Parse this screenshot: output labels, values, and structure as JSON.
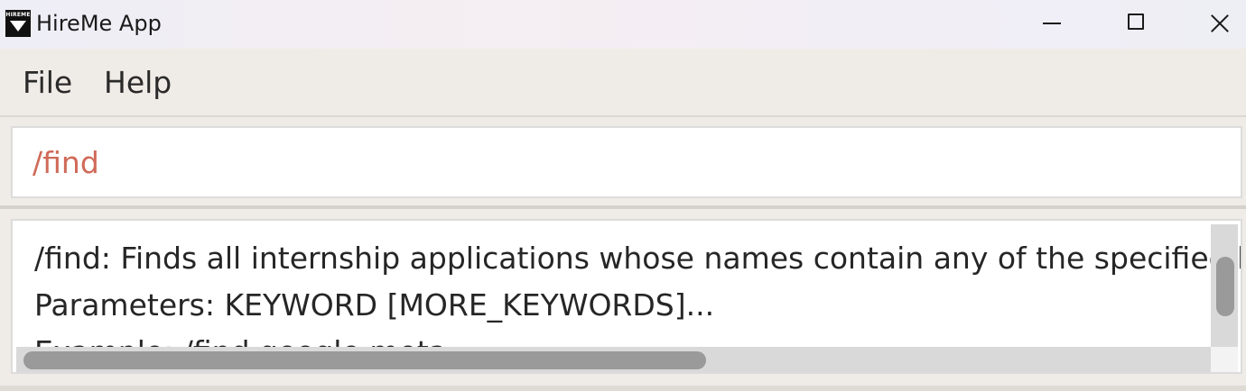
{
  "window": {
    "title": "HireMe App",
    "icon": "hireme-logo-icon",
    "icon_text": "HIREME",
    "controls": [
      "minimize-icon",
      "maximize-icon",
      "close-icon"
    ]
  },
  "menu": {
    "items": [
      {
        "label": "File"
      },
      {
        "label": "Help"
      }
    ]
  },
  "command_box": {
    "value": "/find",
    "text_color": "#d06a58"
  },
  "result_display": {
    "lines": [
      "/find: Finds all internship applications whose names contain any of the specified keywords",
      "Parameters: KEYWORD [MORE_KEYWORDS]...",
      "Example: /find google meta"
    ]
  }
}
